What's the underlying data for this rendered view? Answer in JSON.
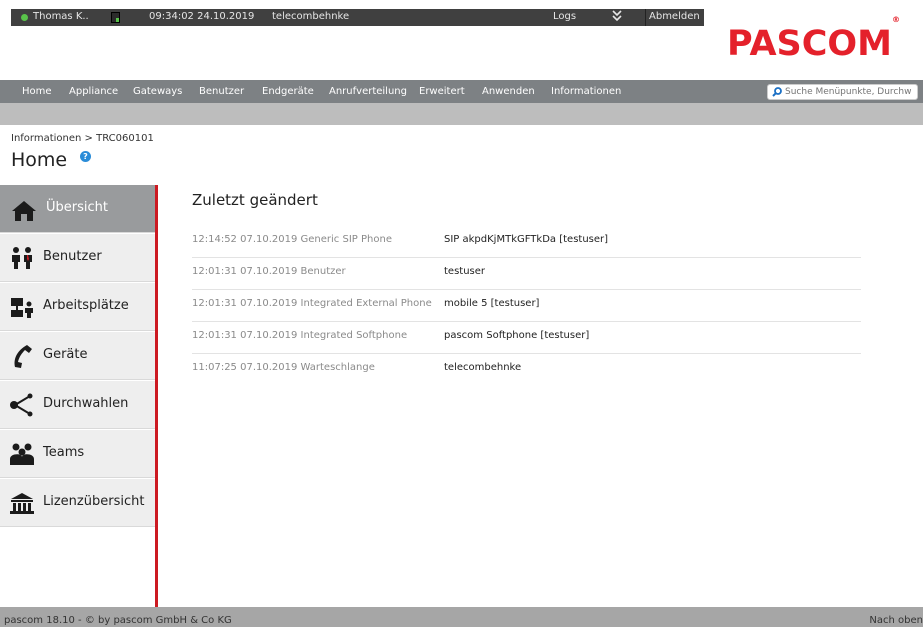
{
  "topbar": {
    "user": "Thomas K..",
    "datetime": "09:34:02 24.10.2019",
    "host": "telecombehnke",
    "logs": "Logs",
    "logout": "Abmelden"
  },
  "logo": {
    "text": "PASCOM",
    "reg": "®",
    "color": "#e4212b"
  },
  "nav": [
    "Home",
    "Appliance",
    "Gateways",
    "Benutzer",
    "Endgeräte",
    "Anrufverteilung",
    "Erweitert",
    "Anwenden",
    "Informationen"
  ],
  "search": {
    "placeholder": "Suche Menüpunkte, Durchw"
  },
  "breadcrumb": "Informationen > TRC060101",
  "page_title": "Home",
  "sidebar": [
    {
      "label": "Übersicht",
      "icon": "home-icon"
    },
    {
      "label": "Benutzer",
      "icon": "users-icon"
    },
    {
      "label": "Arbeitsplätze",
      "icon": "workstation-icon"
    },
    {
      "label": "Geräte",
      "icon": "phone-icon"
    },
    {
      "label": "Durchwahlen",
      "icon": "share-icon"
    },
    {
      "label": "Teams",
      "icon": "team-icon"
    },
    {
      "label": "Lizenzübersicht",
      "icon": "bank-icon"
    }
  ],
  "main": {
    "title": "Zuletzt geändert",
    "rows": [
      {
        "meta": "12:14:52 07.10.2019 Generic SIP Phone",
        "value": "SIP akpdKjMTkGFTkDa [testuser]"
      },
      {
        "meta": "12:01:31 07.10.2019 Benutzer",
        "value": "testuser"
      },
      {
        "meta": "12:01:31 07.10.2019 Integrated External Phone",
        "value": "mobile 5 [testuser]"
      },
      {
        "meta": "12:01:31 07.10.2019 Integrated Softphone",
        "value": "pascom Softphone [testuser]"
      },
      {
        "meta": "11:07:25 07.10.2019 Warteschlange",
        "value": "telecombehnke"
      }
    ]
  },
  "footer": {
    "left": "pascom 18.10 - © by pascom GmbH & Co KG",
    "right": "Nach oben"
  }
}
